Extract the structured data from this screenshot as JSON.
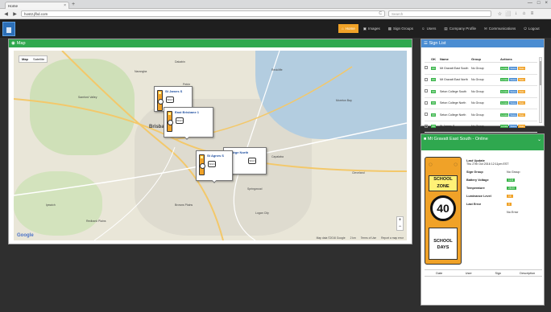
{
  "browser": {
    "tab_title": "Home",
    "tab_close": "×",
    "new_tab": "+",
    "url": "host2.jfbd.com",
    "reload": "C",
    "search_placeholder": "Search",
    "win_min": "—",
    "win_max": "□",
    "win_close": "×",
    "back": "◀",
    "forward": "▶",
    "star": "☆",
    "bookmark": "⬜",
    "download": "↓",
    "home": "⌂",
    "menu": "≡"
  },
  "nav": {
    "items": [
      {
        "label": "Home",
        "icon": "⌂",
        "active": true
      },
      {
        "label": "Images",
        "icon": "▣",
        "active": false
      },
      {
        "label": "Sign Groups",
        "icon": "▦",
        "active": false
      },
      {
        "label": "Users",
        "icon": "☺",
        "active": false
      },
      {
        "label": "Company Profile",
        "icon": "▤",
        "active": false
      },
      {
        "label": "Communications",
        "icon": "✉",
        "active": false
      },
      {
        "label": "Logout",
        "icon": "⏻",
        "active": false
      }
    ]
  },
  "map_panel": {
    "title": "Map",
    "map_type_map": "Map",
    "map_type_sat": "Satellite",
    "zoom_in": "+",
    "zoom_out": "−",
    "google": "Google",
    "footer_data": "Map data ©2016 Google",
    "footer_scale": "2 km",
    "footer_terms": "Terms of Use",
    "footer_report": "Report a map error",
    "places": [
      {
        "name": "Dakabin"
      },
      {
        "name": "Redcliffe"
      },
      {
        "name": "Narangba"
      },
      {
        "name": "Petrie"
      },
      {
        "name": "Samford Valley"
      },
      {
        "name": "Brisbane"
      },
      {
        "name": "Moreton Bay"
      },
      {
        "name": "Capalaba"
      },
      {
        "name": "Springwood"
      },
      {
        "name": "Logan City"
      },
      {
        "name": "Ipswich"
      },
      {
        "name": "Redbank Plains"
      },
      {
        "name": "Cleveland"
      },
      {
        "name": "Browns Plains"
      }
    ],
    "popups": [
      {
        "title": "St James S",
        "icon_text": "SIGN"
      },
      {
        "title": "East Brisbane 1",
        "icon_text": "SIGN"
      },
      {
        "title": "St Agnes S",
        "icon_text": "SIGN"
      },
      {
        "title": "College North",
        "icon_text": "SIGN"
      }
    ]
  },
  "sign_list": {
    "title": "Sign List",
    "headers": {
      "ok": "OK",
      "name": "Name",
      "group": "Group",
      "actions": "Actions"
    },
    "rows": [
      {
        "ok": "OK",
        "name": "Mt Gravatt East South",
        "group": "No Group"
      },
      {
        "ok": "OK",
        "name": "Mt Gravatt East North",
        "group": "No Group"
      },
      {
        "ok": "OK",
        "name": "Seton College South",
        "group": "No Group"
      },
      {
        "ok": "OK",
        "name": "Seton College North",
        "group": "No Group"
      },
      {
        "ok": "OK",
        "name": "Seton College North",
        "group": "No Group"
      },
      {
        "ok": "OK",
        "name": "St James S",
        "group": "No Group"
      }
    ],
    "actions": [
      "Locate",
      "Status",
      "Stats"
    ]
  },
  "sign_detail": {
    "title": "Mt Gravatt East South - Online",
    "chevron": "⌄",
    "sign_top_left": "◌",
    "sign_top_right": "◌",
    "sign_zone_line1": "SCHOOL",
    "sign_zone_line2": "ZONE",
    "sign_speed": "40",
    "sign_days_line1": "SCHOOL",
    "sign_days_line2": "DAYS",
    "last_update_label": "Last Update",
    "last_update_time": "Thu 27th Oct 2016 12:11pm EST",
    "rows": [
      {
        "label": "Sign Group",
        "value": "No Group",
        "pill": ""
      },
      {
        "label": "Battery Voltage",
        "value": "12.8",
        "pill": "green"
      },
      {
        "label": "Temperature",
        "value": "28.00",
        "pill": "green"
      },
      {
        "label": "Luminance Level",
        "value": "16",
        "pill": "orange"
      },
      {
        "label": "Last Error",
        "value": "0",
        "pill": "orange"
      },
      {
        "label": "",
        "value": "No Error",
        "pill": ""
      }
    ],
    "table_headers": [
      "Date",
      "User",
      "Sign",
      "Description"
    ]
  },
  "colors": {
    "accent_orange": "#f0a228",
    "header_green": "#2fa84f",
    "header_blue": "#4b8dd2",
    "nav_bg": "#1f1f1f"
  }
}
